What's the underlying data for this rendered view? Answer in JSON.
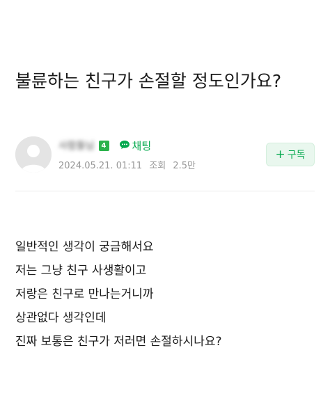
{
  "post": {
    "title": "불륜하는 친구가 손절할 정도인가요?",
    "author": {
      "nickname": "사람들님",
      "level": "4",
      "avatar_icon": "default-profile-icon"
    },
    "chat": {
      "icon": "chat-bubble-icon",
      "label": "채팅"
    },
    "meta": {
      "date": "2024.05.21. 01:11",
      "views_label": "조회",
      "views": "2.5만"
    },
    "subscribe": {
      "icon": "plus-icon",
      "label": "구독"
    },
    "body_lines": [
      "일반적인 생각이 궁금해서요",
      "저는 그냥 친구 사생활이고",
      "저랑은 친구로 만나는거니까",
      "상관없다 생각인데",
      "진짜 보통은 친구가 저러면 손절하시나요?"
    ]
  },
  "colors": {
    "accent": "#03a94d",
    "badge": "#2bb24c",
    "subscribe_bg": "#e9f7ee",
    "meta_text": "#979797"
  }
}
